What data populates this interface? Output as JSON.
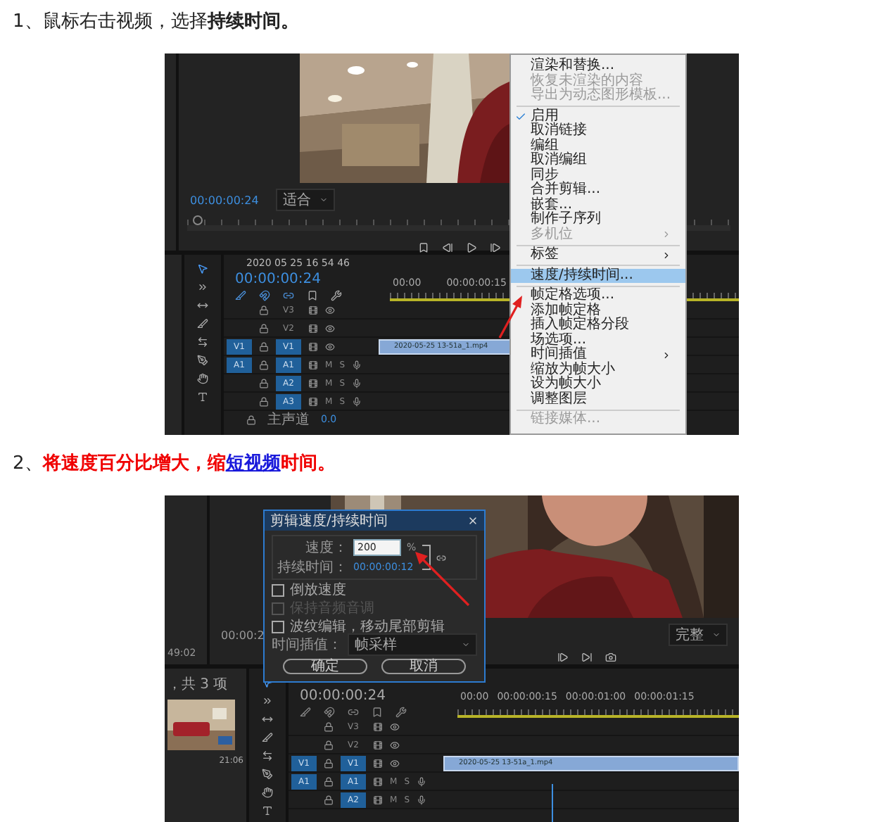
{
  "step_1": {
    "caption": [
      {
        "kind": "plain",
        "text": "1、鼠标右击视频，选择"
      },
      {
        "kind": "strong",
        "text": "持续时间。"
      }
    ],
    "screenshot": {
      "monitor": {
        "timecode": "00:00:00:24",
        "zoom": "适合"
      },
      "timeline": {
        "sequence": "2020 05 25 16 54 46",
        "timecode": "00:00:00:24",
        "ruler": [
          "00:00",
          "00:00:00:15"
        ],
        "tracks": [
          {
            "kind": "video",
            "label": "V3",
            "targeted": false
          },
          {
            "kind": "video",
            "label": "V2",
            "targeted": false
          },
          {
            "kind": "video",
            "label": "V1",
            "source": "V1",
            "targeted": true,
            "clip": "2020-05-25 13-51a_1.mp4"
          },
          {
            "kind": "audio",
            "label": "A1",
            "source": "A1",
            "targeted": true,
            "buttons": [
              "M",
              "S"
            ]
          },
          {
            "kind": "audio",
            "label": "A2",
            "targeted": true,
            "buttons": [
              "M",
              "S"
            ]
          },
          {
            "kind": "audio",
            "label": "A3",
            "targeted": true,
            "buttons": [
              "M",
              "S"
            ]
          }
        ],
        "master": {
          "label": "主声道",
          "value": "0.0"
        }
      },
      "context_menu": [
        {
          "kind": "item",
          "label": "渲染和替换...",
          "disabled": false,
          "checked": false,
          "submenu": false,
          "selected": false
        },
        {
          "kind": "item",
          "label": "恢复未渲染的内容",
          "disabled": true,
          "checked": false,
          "submenu": false,
          "selected": false
        },
        {
          "kind": "item",
          "label": "导出为动态图形模板...",
          "disabled": true,
          "checked": false,
          "submenu": false,
          "selected": false
        },
        {
          "kind": "separator"
        },
        {
          "kind": "item",
          "label": "启用",
          "disabled": false,
          "checked": true,
          "submenu": false,
          "selected": false
        },
        {
          "kind": "item",
          "label": "取消链接",
          "disabled": false,
          "checked": false,
          "submenu": false,
          "selected": false
        },
        {
          "kind": "item",
          "label": "编组",
          "disabled": false,
          "checked": false,
          "submenu": false,
          "selected": false
        },
        {
          "kind": "item",
          "label": "取消编组",
          "disabled": false,
          "checked": false,
          "submenu": false,
          "selected": false
        },
        {
          "kind": "item",
          "label": "同步",
          "disabled": false,
          "checked": false,
          "submenu": false,
          "selected": false
        },
        {
          "kind": "item",
          "label": "合并剪辑...",
          "disabled": false,
          "checked": false,
          "submenu": false,
          "selected": false
        },
        {
          "kind": "item",
          "label": "嵌套...",
          "disabled": false,
          "checked": false,
          "submenu": false,
          "selected": false
        },
        {
          "kind": "item",
          "label": "制作子序列",
          "disabled": false,
          "checked": false,
          "submenu": false,
          "selected": false
        },
        {
          "kind": "item",
          "label": "多机位",
          "disabled": true,
          "checked": false,
          "submenu": true,
          "selected": false
        },
        {
          "kind": "separator"
        },
        {
          "kind": "item",
          "label": "标签",
          "disabled": false,
          "checked": false,
          "submenu": true,
          "selected": false
        },
        {
          "kind": "separator"
        },
        {
          "kind": "item",
          "label": "速度/持续时间...",
          "disabled": false,
          "checked": false,
          "submenu": false,
          "selected": true
        },
        {
          "kind": "separator"
        },
        {
          "kind": "item",
          "label": "帧定格选项...",
          "disabled": false,
          "checked": false,
          "submenu": false,
          "selected": false
        },
        {
          "kind": "item",
          "label": "添加帧定格",
          "disabled": false,
          "checked": false,
          "submenu": false,
          "selected": false
        },
        {
          "kind": "item",
          "label": "插入帧定格分段",
          "disabled": false,
          "checked": false,
          "submenu": false,
          "selected": false
        },
        {
          "kind": "item",
          "label": "场选项...",
          "disabled": false,
          "checked": false,
          "submenu": false,
          "selected": false
        },
        {
          "kind": "item",
          "label": "时间插值",
          "disabled": false,
          "checked": false,
          "submenu": true,
          "selected": false
        },
        {
          "kind": "item",
          "label": "缩放为帧大小",
          "disabled": false,
          "checked": false,
          "submenu": false,
          "selected": false
        },
        {
          "kind": "item",
          "label": "设为帧大小",
          "disabled": false,
          "checked": false,
          "submenu": false,
          "selected": false
        },
        {
          "kind": "item",
          "label": "调整图层",
          "disabled": false,
          "checked": false,
          "submenu": false,
          "selected": false
        },
        {
          "kind": "separator"
        },
        {
          "kind": "item",
          "label": "链接媒体...",
          "disabled": true,
          "checked": false,
          "submenu": false,
          "selected": false
        }
      ]
    }
  },
  "step_2": {
    "caption": [
      {
        "kind": "plain",
        "text": "2、"
      },
      {
        "kind": "emphasis",
        "text": "将速度百分比增大，缩"
      },
      {
        "kind": "link",
        "text": "短视频"
      },
      {
        "kind": "emphasis",
        "text": "时间。"
      }
    ],
    "screenshot": {
      "source_monitor": {
        "timecode": "49:02"
      },
      "monitor": {
        "timecode": "00:00:2",
        "zoom": "完整"
      },
      "project": {
        "count": "，共 3 项",
        "duration": "21:06"
      },
      "dialog": {
        "title": "剪辑速度/持续时间",
        "speed_label": "速度：",
        "speed": "200",
        "unit": "%",
        "duration_label": "持续时间：",
        "duration": "00:00:00:12",
        "options": [
          {
            "label": "倒放速度",
            "checked": false,
            "disabled": false
          },
          {
            "label": "保持音频音调",
            "checked": false,
            "disabled": true
          },
          {
            "label": "波纹编辑，移动尾部剪辑",
            "checked": false,
            "disabled": false
          }
        ],
        "interpolation_label": "时间插值：",
        "interpolation": "帧采样",
        "buttons": [
          "确定",
          "取消"
        ]
      },
      "timeline": {
        "timecode": "00:00:00:24",
        "ruler": [
          "00:00",
          "00:00:00:15",
          "00:00:01:00",
          "00:00:01:15"
        ],
        "tracks": [
          {
            "kind": "video",
            "label": "V3",
            "targeted": false
          },
          {
            "kind": "video",
            "label": "V2",
            "targeted": false
          },
          {
            "kind": "video",
            "label": "V1",
            "source": "V1",
            "targeted": true,
            "clip": "2020-05-25 13-51a_1.mp4"
          },
          {
            "kind": "audio",
            "label": "A1",
            "source": "A1",
            "targeted": true,
            "buttons": [
              "M",
              "S"
            ]
          },
          {
            "kind": "audio",
            "label": "A2",
            "targeted": true,
            "buttons": [
              "M",
              "S"
            ]
          }
        ]
      }
    }
  }
}
